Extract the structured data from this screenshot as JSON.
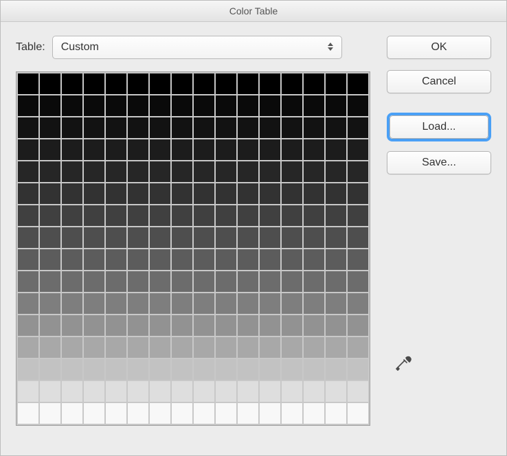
{
  "window": {
    "title": "Color Table"
  },
  "table": {
    "label": "Table:",
    "selected": "Custom"
  },
  "buttons": {
    "ok": "OK",
    "cancel": "Cancel",
    "load": "Load...",
    "save": "Save..."
  },
  "tools": {
    "eyedropper": "eyedropper"
  },
  "grid": {
    "cols": 16,
    "rows": 16,
    "gray_levels": [
      0,
      10,
      18,
      28,
      38,
      50,
      64,
      78,
      92,
      108,
      126,
      146,
      168,
      194,
      222,
      248
    ]
  }
}
